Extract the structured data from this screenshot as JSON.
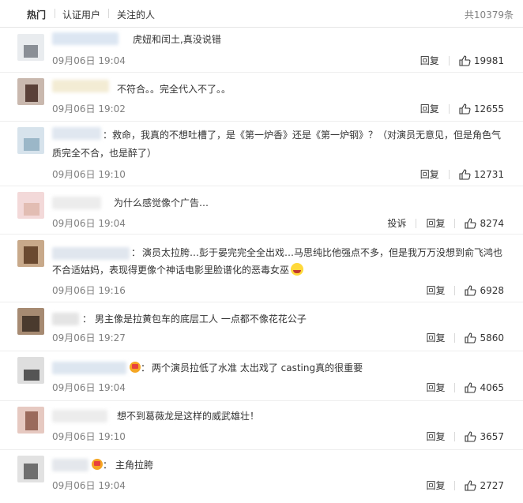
{
  "tabs": [
    "热门",
    "认证用户",
    "关注的人"
  ],
  "total_label": "共10379条",
  "labels": {
    "reply": "回复",
    "report": "投诉"
  },
  "comments": [
    {
      "sep": "",
      "text": "虎妞和闰土,真没说错",
      "time": "09月06日 19:04",
      "likes": "19981"
    },
    {
      "sep": "",
      "text": "不符合。。完全代入不了。。",
      "time": "09月06日 19:02",
      "likes": "12655"
    },
    {
      "sep": "：",
      "text_lines": [
        "救命，我真的不想吐槽了，是《第一炉香》还是《第一炉钢》？（对演员无意见，但是角色气",
        "质完全不合，也是醉了）"
      ],
      "time": "09月06日 19:10",
      "likes": "12731"
    },
    {
      "sep": "",
      "text": "为什么感觉像个广告…",
      "time": "09月06日 19:04",
      "likes": "8274"
    },
    {
      "sep": "：",
      "text_lines": [
        "演员太拉胯…彭于晏完完全全出戏…马思纯比他强点不多，但是我万万没想到俞飞鸿也",
        "不合适姑妈，表现得更像个神话电影里脸谱化的恶毒女巫"
      ],
      "time": "09月06日 19:16",
      "likes": "6928"
    },
    {
      "sep": "：",
      "text": "男主像是拉黄包车的底层工人 一点都不像花花公子",
      "time": "09月06日 19:27",
      "likes": "5860"
    },
    {
      "sep": "：",
      "text": "两个演员拉低了水准 太出戏了 casting真的很重要",
      "time": "09月06日 19:04",
      "likes": "4065"
    },
    {
      "sep": "",
      "text": "想不到葛薇龙是这样的威武雄壮！",
      "time": "09月06日 19:10",
      "likes": "3657"
    },
    {
      "sep": "：",
      "text": "主角拉胯",
      "time": "09月06日 19:04",
      "likes": "2727"
    }
  ]
}
